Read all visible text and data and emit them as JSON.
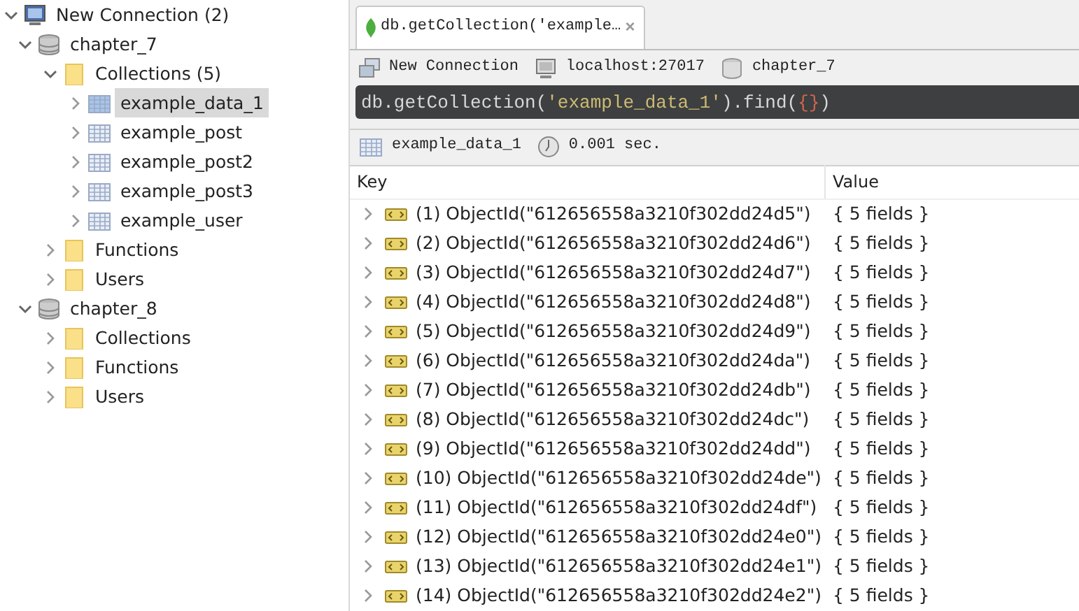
{
  "tree": [
    {
      "label": "New Connection (2)",
      "kind": "server",
      "expanded": true,
      "selected": false,
      "children": [
        {
          "label": "chapter_7",
          "kind": "database",
          "expanded": true,
          "selected": false,
          "children": [
            {
              "label": "Collections (5)",
              "kind": "folder",
              "expanded": true,
              "selected": false,
              "children": [
                {
                  "label": "example_data_1",
                  "kind": "collection",
                  "expanded": false,
                  "selected": true
                },
                {
                  "label": "example_post",
                  "kind": "collection",
                  "expanded": false,
                  "selected": false
                },
                {
                  "label": "example_post2",
                  "kind": "collection",
                  "expanded": false,
                  "selected": false
                },
                {
                  "label": "example_post3",
                  "kind": "collection",
                  "expanded": false,
                  "selected": false
                },
                {
                  "label": "example_user",
                  "kind": "collection",
                  "expanded": false,
                  "selected": false
                }
              ]
            },
            {
              "label": "Functions",
              "kind": "folder",
              "expanded": false,
              "selected": false
            },
            {
              "label": "Users",
              "kind": "folder",
              "expanded": false,
              "selected": false
            }
          ]
        },
        {
          "label": "chapter_8",
          "kind": "database",
          "expanded": true,
          "selected": false,
          "children": [
            {
              "label": "Collections",
              "kind": "folder",
              "expanded": false,
              "selected": false
            },
            {
              "label": "Functions",
              "kind": "folder",
              "expanded": false,
              "selected": false
            },
            {
              "label": "Users",
              "kind": "folder",
              "expanded": false,
              "selected": false
            }
          ]
        }
      ]
    }
  ],
  "tabs": [
    {
      "label": "db.getCollection('example…",
      "close": "×",
      "selected": true
    }
  ],
  "connection_bar": {
    "connection": "New Connection",
    "host": "localhost:27017",
    "database": "chapter_7"
  },
  "query": [
    {
      "kind": "plain",
      "text": "db.getCollection("
    },
    {
      "kind": "string",
      "text": "'example_data_1'"
    },
    {
      "kind": "plain",
      "text": ").find("
    },
    {
      "kind": "brace",
      "text": "{}"
    },
    {
      "kind": "plain",
      "text": ")"
    }
  ],
  "result_bar": {
    "collection": "example_data_1",
    "time": "0.001 sec."
  },
  "table": {
    "columns": [
      "Key",
      "Value"
    ],
    "rows": [
      {
        "key": "(1) ObjectId(\"612656558a3210f302dd24d5\")",
        "value": "{ 5 fields }"
      },
      {
        "key": "(2) ObjectId(\"612656558a3210f302dd24d6\")",
        "value": "{ 5 fields }"
      },
      {
        "key": "(3) ObjectId(\"612656558a3210f302dd24d7\")",
        "value": "{ 5 fields }"
      },
      {
        "key": "(4) ObjectId(\"612656558a3210f302dd24d8\")",
        "value": "{ 5 fields }"
      },
      {
        "key": "(5) ObjectId(\"612656558a3210f302dd24d9\")",
        "value": "{ 5 fields }"
      },
      {
        "key": "(6) ObjectId(\"612656558a3210f302dd24da\")",
        "value": "{ 5 fields }"
      },
      {
        "key": "(7) ObjectId(\"612656558a3210f302dd24db\")",
        "value": "{ 5 fields }"
      },
      {
        "key": "(8) ObjectId(\"612656558a3210f302dd24dc\")",
        "value": "{ 5 fields }"
      },
      {
        "key": "(9) ObjectId(\"612656558a3210f302dd24dd\")",
        "value": "{ 5 fields }"
      },
      {
        "key": "(10) ObjectId(\"612656558a3210f302dd24de\")",
        "value": "{ 5 fields }"
      },
      {
        "key": "(11) ObjectId(\"612656558a3210f302dd24df\")",
        "value": "{ 5 fields }"
      },
      {
        "key": "(12) ObjectId(\"612656558a3210f302dd24e0\")",
        "value": "{ 5 fields }"
      },
      {
        "key": "(13) ObjectId(\"612656558a3210f302dd24e1\")",
        "value": "{ 5 fields }"
      },
      {
        "key": "(14) ObjectId(\"612656558a3210f302dd24e2\")",
        "value": "{ 5 fields }"
      }
    ]
  }
}
